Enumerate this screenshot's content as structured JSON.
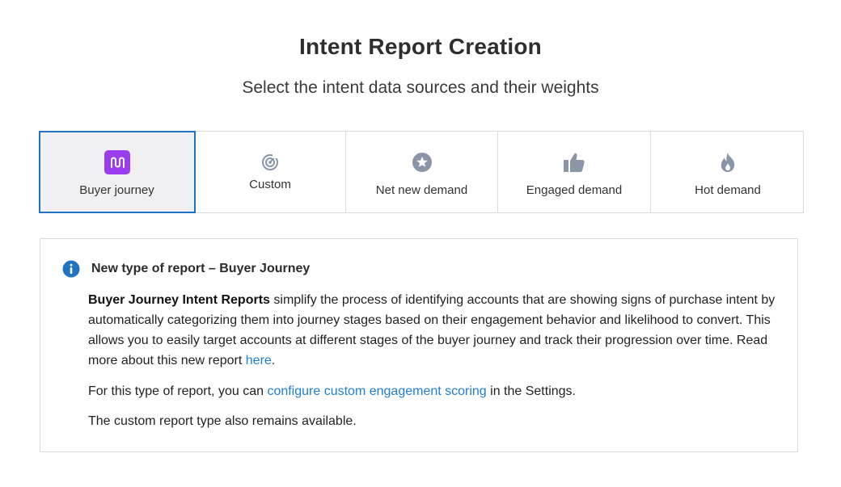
{
  "page": {
    "title": "Intent Report Creation",
    "subtitle": "Select the intent data sources and their weights"
  },
  "options": [
    {
      "label": "Buyer journey",
      "icon": "route-icon",
      "selected": true
    },
    {
      "label": "Custom",
      "icon": "target-icon",
      "selected": false
    },
    {
      "label": "Net new demand",
      "icon": "star-icon",
      "selected": false
    },
    {
      "label": "Engaged demand",
      "icon": "thumbs-up-icon",
      "selected": false
    },
    {
      "label": "Hot demand",
      "icon": "flame-icon",
      "selected": false
    }
  ],
  "info": {
    "icon": "info-icon",
    "heading": "New type of report – Buyer Journey",
    "p1_bold": "Buyer Journey Intent Reports",
    "p1_text": " simplify the process of identifying accounts that are showing signs of purchase intent by automatically categorizing them into journey stages based on their engagement behavior and likelihood to convert. This allows you to easily target accounts at different stages of the buyer journey and track their progression over time. Read more about this new report ",
    "p1_link": "here",
    "p1_end": ".",
    "p2_text": "For this type of report, you can ",
    "p2_link": "configure custom engagement scoring",
    "p2_end": " in the Settings.",
    "p3_text": "The custom report type also remains available."
  },
  "colors": {
    "selected_border": "#1f73c1",
    "selected_bg": "#f0f0f2",
    "accent_purple": "#9b3cf0",
    "icon_gray": "#8a96a8",
    "info_blue": "#1f73c1",
    "link_blue": "#1f7ed8"
  }
}
